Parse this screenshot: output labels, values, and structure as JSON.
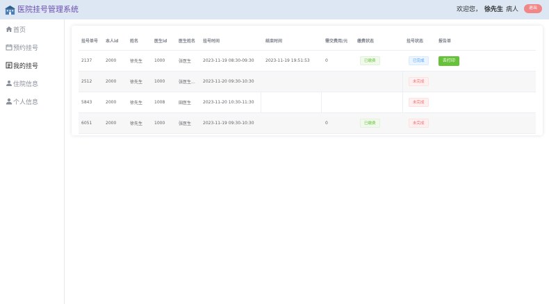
{
  "header": {
    "app_title": "医院挂号管理系统",
    "welcome": "欢迎您，",
    "user_name": "徐先生",
    "role": "病人",
    "logout_label": "退出",
    "accent_color": "#6a4fb0",
    "logout_color": "#f08686"
  },
  "sidebar": {
    "items": [
      {
        "label": "首页",
        "icon": "home-icon",
        "active": false
      },
      {
        "label": "预约挂号",
        "icon": "calendar-icon",
        "active": false
      },
      {
        "label": "我的挂号",
        "icon": "list-icon",
        "active": true
      },
      {
        "label": "住院信息",
        "icon": "bed-icon",
        "active": false
      },
      {
        "label": "个人信息",
        "icon": "user-icon",
        "active": false
      }
    ]
  },
  "table": {
    "columns": [
      "挂号单号",
      "本人id",
      "姓名",
      "医生id",
      "医生姓名",
      "挂号时间",
      "结束时间",
      "需交费用/元",
      "缴费状态",
      "挂号状态",
      "报告单"
    ],
    "rows": [
      {
        "id": "2137",
        "self_id": "2000",
        "name": "徐先生",
        "doctor_id": "1000",
        "doctor_name": "张医生",
        "time": "2023-11-19 08:30-09:30",
        "end_time": "2023-11-19 19:51:53",
        "fee": "0",
        "pay_status": "已缴费",
        "reg_status": "已完成",
        "report": "去打印"
      },
      {
        "id": "2512",
        "self_id": "2000",
        "name": "徐先生",
        "doctor_id": "1000",
        "doctor_name": "张医生...",
        "time": "2023-11-20 09:30-10:30",
        "end_time": "",
        "fee": "",
        "pay_status": "",
        "reg_status": "未完成",
        "report": ""
      },
      {
        "id": "5843",
        "self_id": "2000",
        "name": "徐先生",
        "doctor_id": "1008",
        "doctor_name": "田医生",
        "time": "2023-11-20 10:30-11:30",
        "end_time": "",
        "fee": "",
        "pay_status": "",
        "reg_status": "未完成",
        "report": ""
      },
      {
        "id": "6051",
        "self_id": "2000",
        "name": "徐先生",
        "doctor_id": "1000",
        "doctor_name": "张医生",
        "time": "2023-11-19 09:30-10:30",
        "end_time": "",
        "fee": "0",
        "pay_status": "已缴费",
        "reg_status": "未完成",
        "report": ""
      }
    ]
  }
}
